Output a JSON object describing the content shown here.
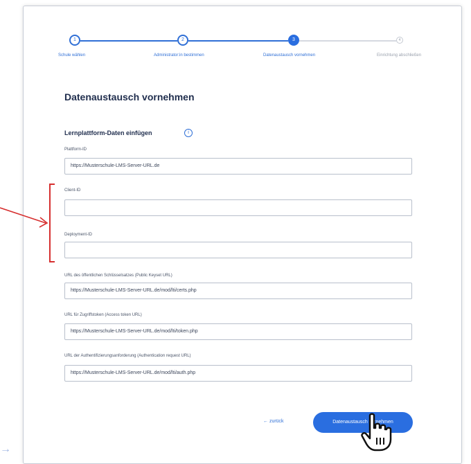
{
  "stepper": {
    "steps": [
      {
        "num": "1",
        "label": "Schule wählen"
      },
      {
        "num": "2",
        "label": "Administrator:in bestimmen"
      },
      {
        "num": "3",
        "label": "Datenaustausch vornehmen"
      },
      {
        "num": "4",
        "label": "Einrichtung abschließen"
      }
    ]
  },
  "form": {
    "title": "Datenaustausch vornehmen",
    "section": "Lernplattform-Daten einfügen",
    "info_icon": "i",
    "fields": [
      {
        "label": "Plattform-ID",
        "value": "https://Musterschule-LMS-Server-URL.de"
      },
      {
        "label": "Client-ID",
        "value": ""
      },
      {
        "label": "Deployment-ID",
        "value": ""
      },
      {
        "label": "URL des öffentlichen Schlüsselsatzes (Public Keyset URL)",
        "value": "https://Musterschule-LMS-Server-URL.de/mod/lti/certs.php"
      },
      {
        "label": "URL für Zugriffstoken (Access token URL)",
        "value": "https://Musterschule-LMS-Server-URL.de/mod/lti/token.php"
      },
      {
        "label": "URL der Authentifizierungsanforderung (Authentication request URL)",
        "value": "https://Musterschule-LMS-Server-URL.de/mod/lti/auth.php"
      }
    ]
  },
  "actions": {
    "back": "← zurück",
    "next": "Datenaustausch vornehmen"
  },
  "colors": {
    "accent": "#2a6ee0",
    "annotation": "#d62f2f"
  },
  "icons": {
    "edge_arrow": "→"
  }
}
